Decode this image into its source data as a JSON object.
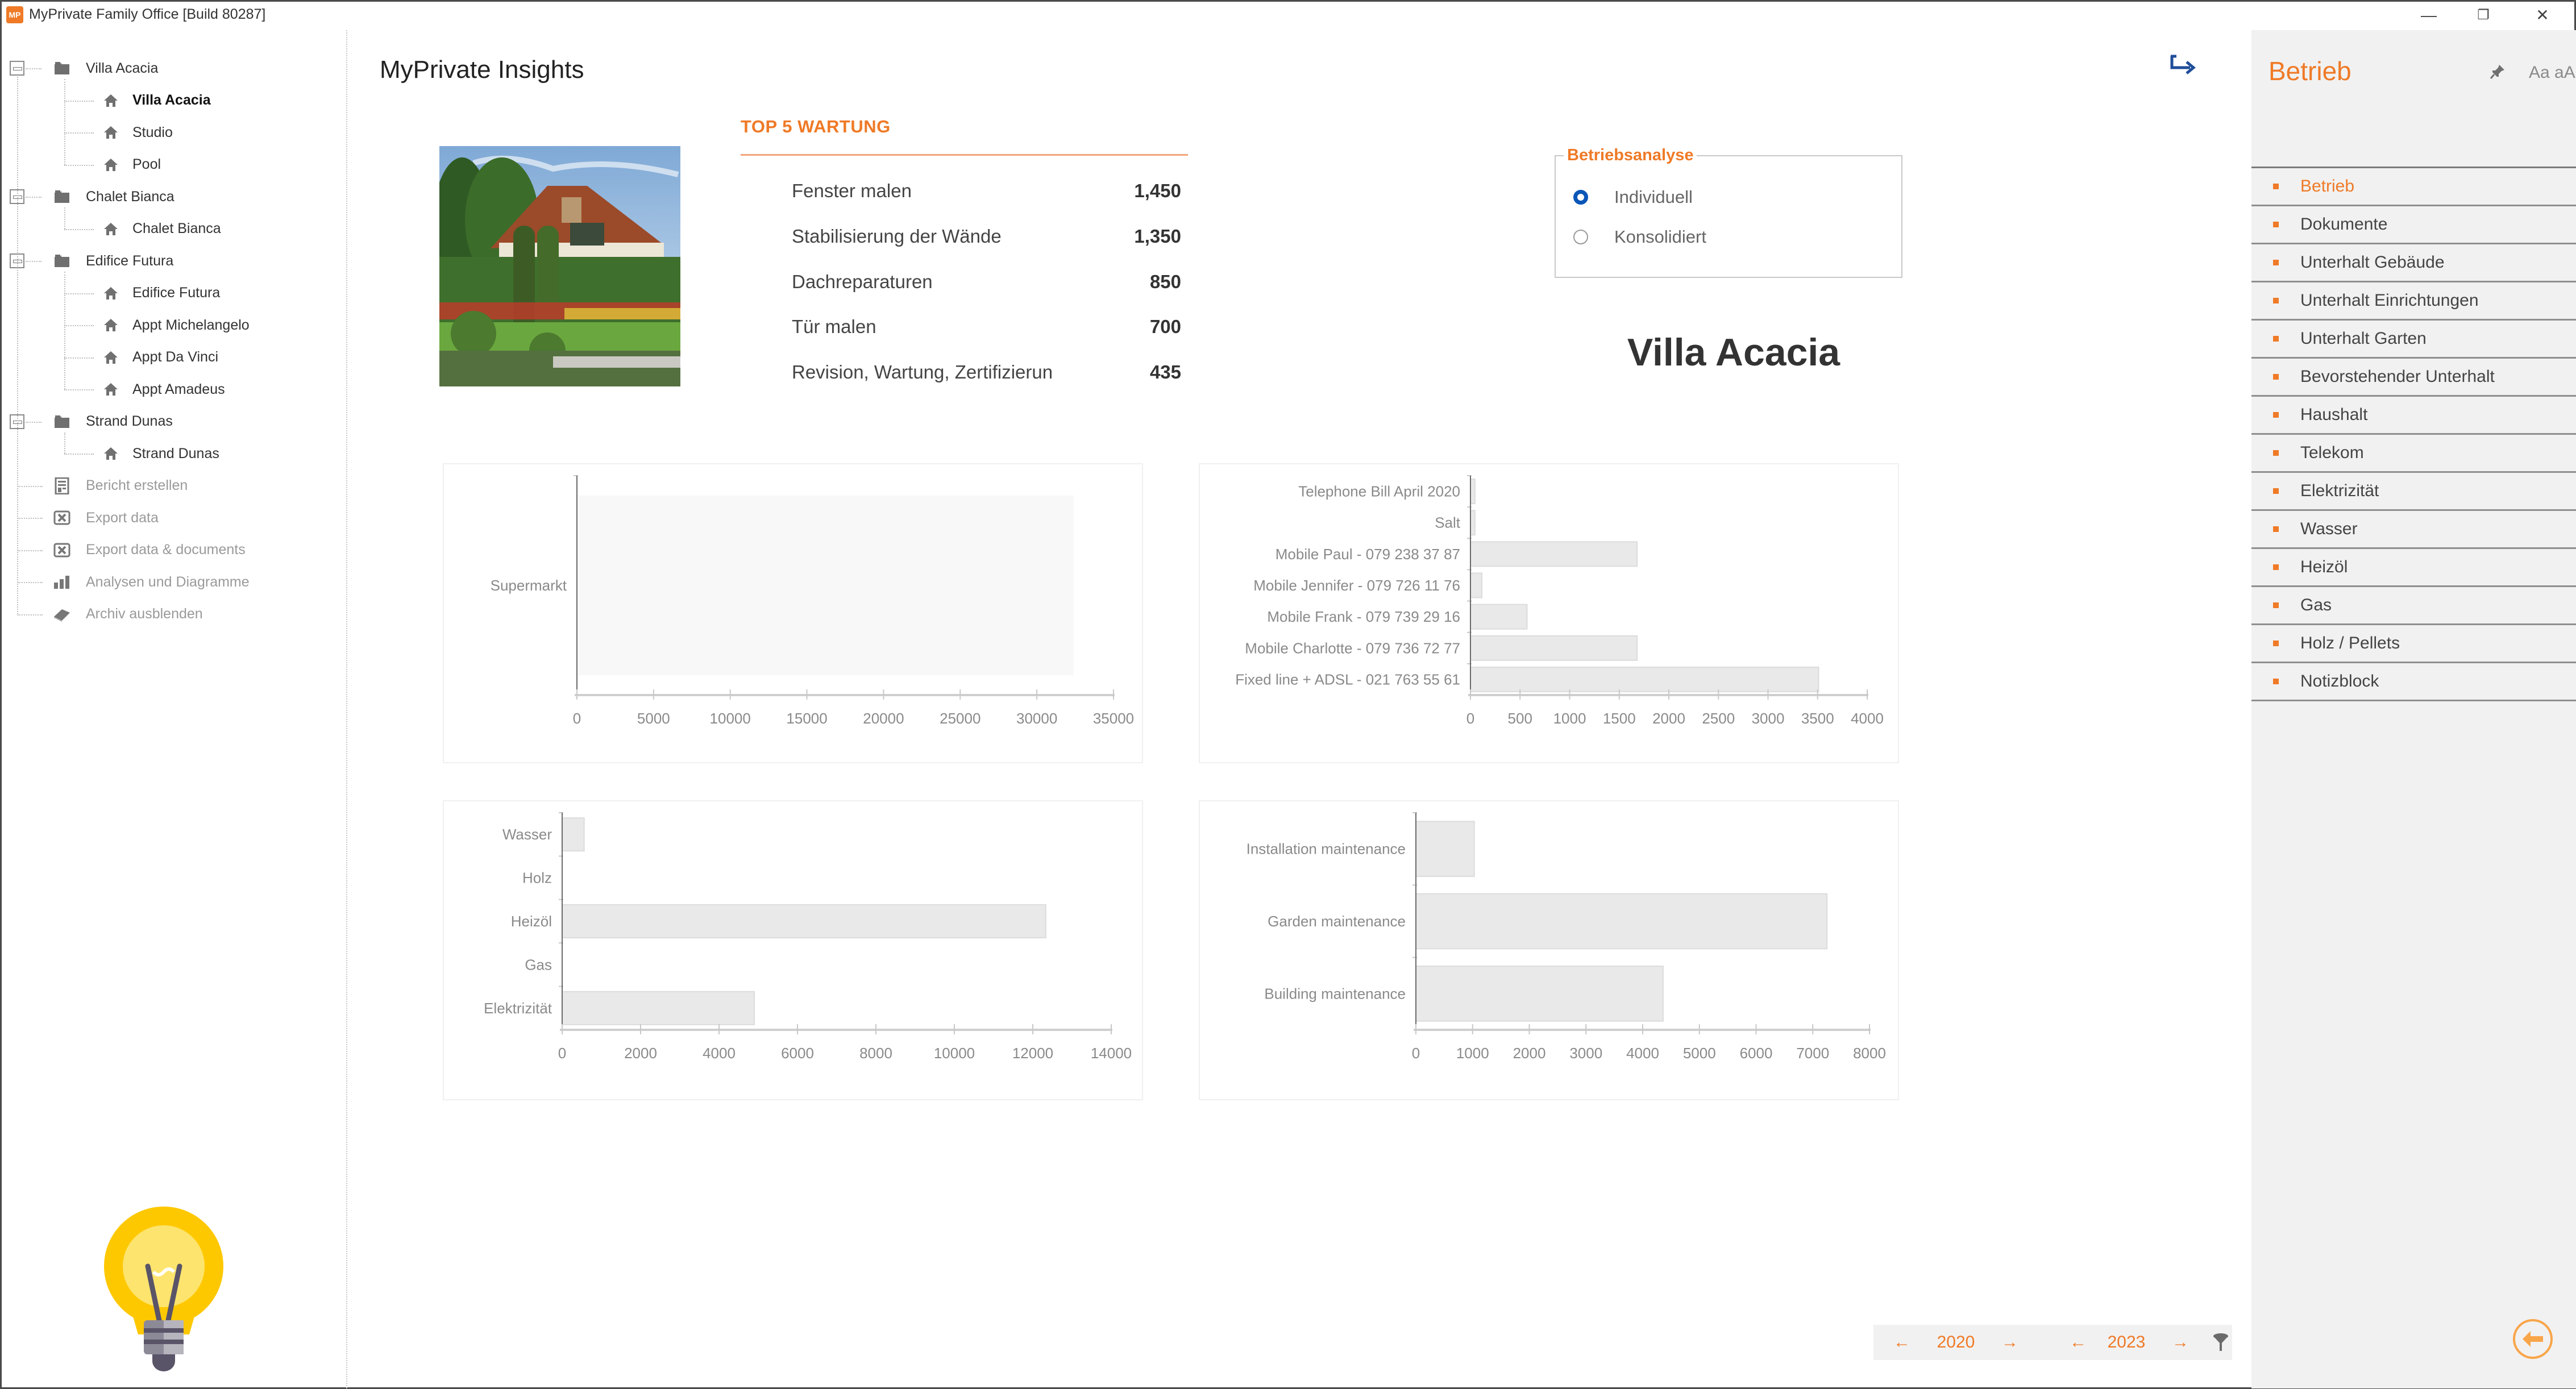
{
  "window": {
    "title": "MyPrivate Family Office [Build 80287]",
    "app_icon_text": "MP",
    "minimize_glyph": "—",
    "restore_glyph": "❐",
    "close_glyph": "✕"
  },
  "tree": {
    "groups": [
      {
        "label": "Villa Acacia",
        "icon": "folder-icon",
        "children": [
          {
            "label": "Villa Acacia",
            "icon": "house-icon",
            "selected": true
          },
          {
            "label": "Studio",
            "icon": "house-icon"
          },
          {
            "label": "Pool",
            "icon": "house-icon"
          }
        ]
      },
      {
        "label": "Chalet Bianca",
        "icon": "folder-icon",
        "children": [
          {
            "label": "Chalet Bianca",
            "icon": "house-icon"
          }
        ]
      },
      {
        "label": "Edifice Futura",
        "icon": "folder-icon",
        "children": [
          {
            "label": "Edifice Futura",
            "icon": "house-icon"
          },
          {
            "label": "Appt Michelangelo",
            "icon": "house-icon"
          },
          {
            "label": "Appt Da Vinci",
            "icon": "house-icon"
          },
          {
            "label": "Appt Amadeus",
            "icon": "house-icon"
          }
        ]
      },
      {
        "label": "Strand Dunas",
        "icon": "folder-icon",
        "children": [
          {
            "label": "Strand Dunas",
            "icon": "house-icon"
          }
        ]
      }
    ],
    "actions": [
      {
        "label": "Bericht erstellen",
        "icon": "report-icon"
      },
      {
        "label": "Export data",
        "icon": "excel-icon"
      },
      {
        "label": "Export data & documents",
        "icon": "excel-icon"
      },
      {
        "label": "Analysen und Diagramme",
        "icon": "bar-chart-icon"
      },
      {
        "label": "Archiv ausblenden",
        "icon": "archive-book-icon"
      }
    ]
  },
  "main": {
    "title": "MyPrivate Insights",
    "top5": {
      "title": "TOP 5 WARTUNG",
      "rows": [
        {
          "name": "Fenster malen",
          "value": "1,450"
        },
        {
          "name": "Stabilisierung der Wände",
          "value": "1,350"
        },
        {
          "name": "Dachreparaturen",
          "value": "850"
        },
        {
          "name": "Tür malen",
          "value": "700"
        },
        {
          "name": "Revision, Wartung, Zertifizierung",
          "value": "435"
        }
      ]
    },
    "analysis": {
      "legend": "Betriebsanalyse",
      "options": [
        {
          "label": "Individuell",
          "checked": true
        },
        {
          "label": "Konsolidiert",
          "checked": false
        }
      ]
    },
    "property_name": "Villa Acacia",
    "year_filter": {
      "prev_glyph": "←",
      "next_glyph": "→",
      "from_year": "2020",
      "to_year": "2023"
    }
  },
  "accent_color": "#ef7a27",
  "bar_color": "#e9e9e9",
  "chart_data": [
    {
      "type": "bar",
      "orientation": "horizontal",
      "title": "",
      "categories": [
        "Supermarkt"
      ],
      "values": [
        32400
      ],
      "xlim": [
        0,
        35000
      ],
      "xticks": [
        0,
        5000,
        10000,
        15000,
        20000,
        25000,
        30000,
        35000
      ],
      "grid": false
    },
    {
      "type": "bar",
      "orientation": "horizontal",
      "title": "",
      "categories": [
        "Telephone Bill April 2020",
        "Salt",
        "Mobile Paul - 079 238 37 87",
        "Mobile Jennifer - 079 726 11 76",
        "Mobile Frank - 079 739 29 16",
        "Mobile Charlotte - 079 736 72 77",
        "Fixed line + ADSL - 021 763 55 61"
      ],
      "values": [
        45,
        45,
        1680,
        115,
        570,
        1680,
        3510
      ],
      "xlim": [
        0,
        4000
      ],
      "xticks": [
        0,
        500,
        1000,
        1500,
        2000,
        2500,
        3000,
        3500,
        4000
      ],
      "grid": false
    },
    {
      "type": "bar",
      "orientation": "horizontal",
      "title": "",
      "categories": [
        "Wasser",
        "Holz",
        "Heizöl",
        "Gas",
        "Elektrizität"
      ],
      "values": [
        560,
        0,
        12330,
        0,
        4900
      ],
      "xlim": [
        0,
        14000
      ],
      "xticks": [
        0,
        2000,
        4000,
        6000,
        8000,
        10000,
        12000,
        14000
      ],
      "grid": false
    },
    {
      "type": "bar",
      "orientation": "horizontal",
      "title": "",
      "categories": [
        "Installation maintenance",
        "Garden maintenance",
        "Building maintenance"
      ],
      "values": [
        1030,
        7250,
        4360
      ],
      "xlim": [
        0,
        8000
      ],
      "xticks": [
        0,
        1000,
        2000,
        3000,
        4000,
        5000,
        6000,
        7000,
        8000
      ],
      "grid": false
    }
  ],
  "right_panel": {
    "title": "Betrieb",
    "font_size_toggle": "Aa aA",
    "items": [
      {
        "label": "Betrieb",
        "active": true
      },
      {
        "label": "Dokumente"
      },
      {
        "label": "Unterhalt Gebäude"
      },
      {
        "label": "Unterhalt Einrichtungen"
      },
      {
        "label": "Unterhalt Garten"
      },
      {
        "label": "Bevorstehender Unterhalt"
      },
      {
        "label": "Haushalt"
      },
      {
        "label": "Telekom"
      },
      {
        "label": "Elektrizität"
      },
      {
        "label": "Wasser"
      },
      {
        "label": "Heizöl"
      },
      {
        "label": "Gas"
      },
      {
        "label": "Holz / Pellets"
      },
      {
        "label": "Notizblock"
      }
    ]
  }
}
